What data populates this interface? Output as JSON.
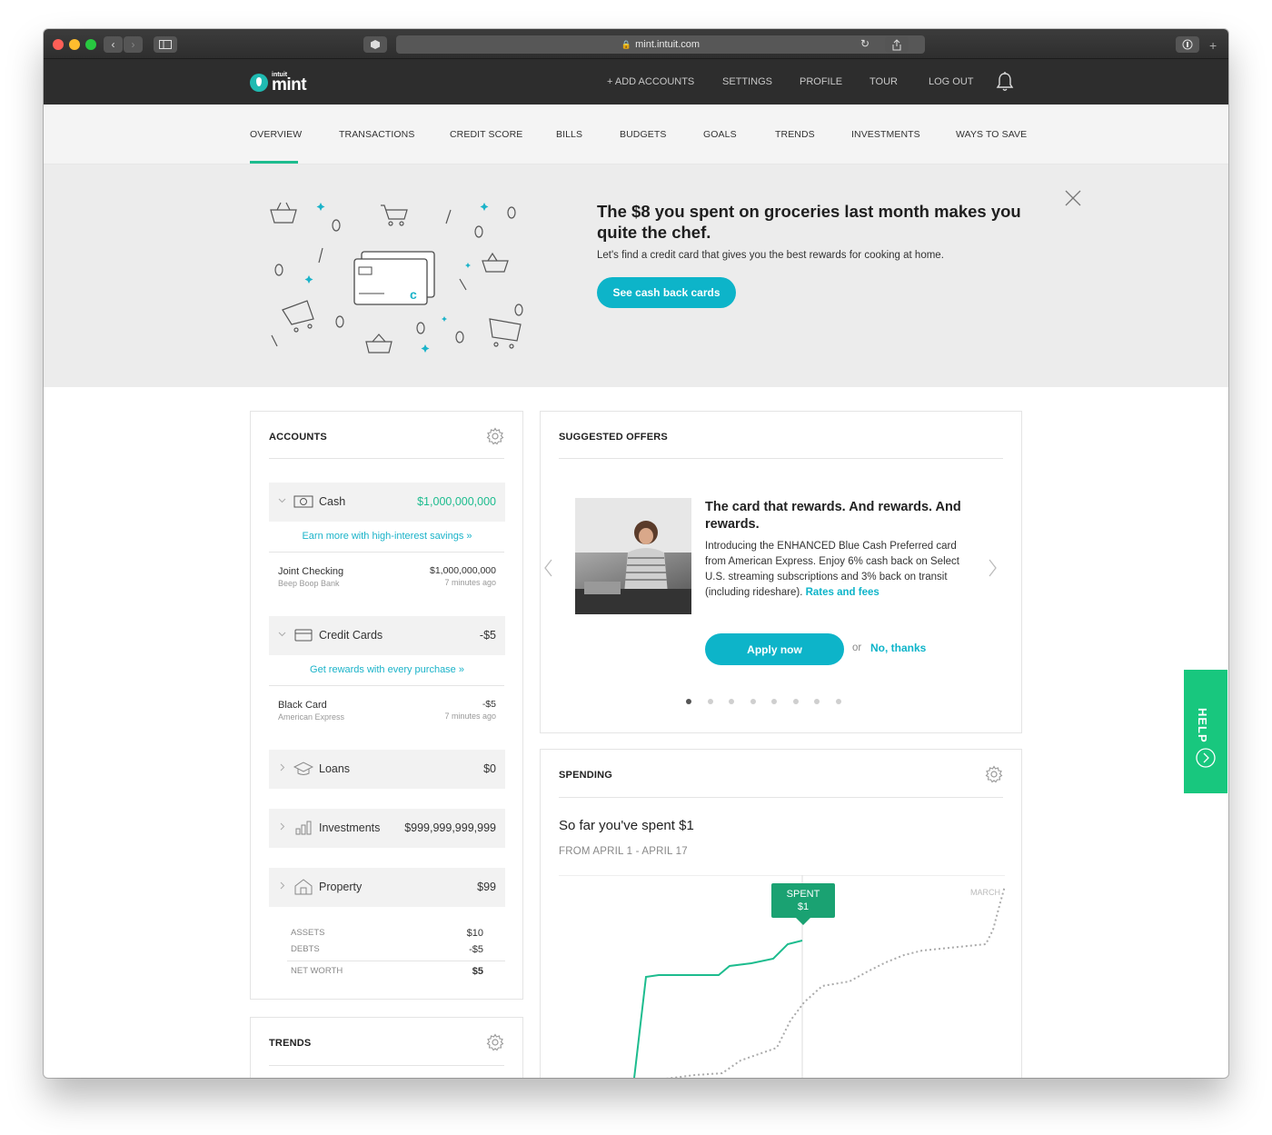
{
  "browser": {
    "url": "mint.intuit.com"
  },
  "header": {
    "logo_small": "intuit",
    "logo_big": "mint",
    "nav": [
      "+ ADD ACCOUNTS",
      "SETTINGS",
      "PROFILE",
      "TOUR",
      "LOG OUT"
    ]
  },
  "tabs": [
    "OVERVIEW",
    "TRANSACTIONS",
    "CREDIT SCORE",
    "BILLS",
    "BUDGETS",
    "GOALS",
    "TRENDS",
    "INVESTMENTS",
    "WAYS TO SAVE"
  ],
  "active_tab": "OVERVIEW",
  "banner": {
    "headline": "The $8 you spent on groceries last month makes you quite the chef.",
    "text": "Let's find a credit card that gives you the best rewards for cooking at home.",
    "button": "See cash back cards"
  },
  "accounts": {
    "title": "ACCOUNTS",
    "cash": {
      "label": "Cash",
      "amount": "$1,000,000,000",
      "promo": "Earn more with high-interest savings »"
    },
    "joint": {
      "name": "Joint Checking",
      "bank": "Beep Boop Bank",
      "amount": "$1,000,000,000",
      "time": "7 minutes ago"
    },
    "credit": {
      "label": "Credit Cards",
      "amount": "-$5",
      "promo": "Get rewards with every purchase »"
    },
    "black": {
      "name": "Black Card",
      "bank": "American Express",
      "amount": "-$5",
      "time": "7 minutes ago"
    },
    "loans": {
      "label": "Loans",
      "amount": "$0"
    },
    "investments": {
      "label": "Investments",
      "amount": "$999,999,999,999"
    },
    "property": {
      "label": "Property",
      "amount": "$99"
    },
    "summary": {
      "assets_label": "ASSETS",
      "assets": "$10",
      "debts_label": "DEBTS",
      "debts": "-$5",
      "net_label": "NET WORTH",
      "net": "$5"
    }
  },
  "trends": {
    "title": "TRENDS"
  },
  "offers": {
    "title": "SUGGESTED OFFERS",
    "headline": "The card that rewards. And rewards. And rewards.",
    "text": "Introducing the ENHANCED Blue Cash Preferred card from American Express. Enjoy 6% cash back on Select U.S. streaming subscriptions and 3% back on transit (including rideshare).",
    "rates_link": "Rates and fees",
    "apply": "Apply now",
    "or": "or",
    "decline": "No, thanks",
    "pages": 8,
    "current_page": 1
  },
  "spending": {
    "title": "SPENDING",
    "headline": "So far you've spent $1",
    "range": "FROM APRIL 1 - APRIL 17",
    "tooltip_label": "SPENT",
    "tooltip_value": "$1",
    "compare_label": "MARCH"
  },
  "help": {
    "label": "HELP"
  },
  "colors": {
    "accent_teal": "#0db4c9",
    "green": "#1dbc8e",
    "header_bg": "#2d2d2d",
    "help_bg": "#18c77e"
  }
}
